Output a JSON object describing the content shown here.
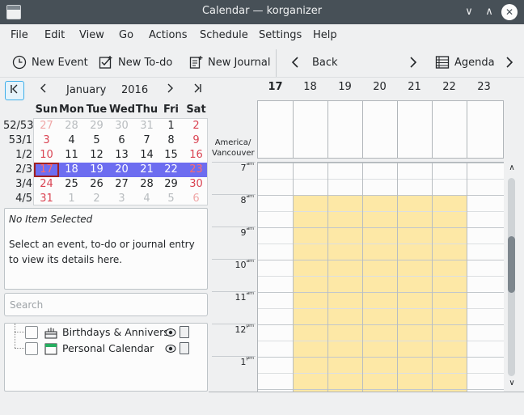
{
  "window": {
    "title": "Calendar  — korganizer",
    "buttons": {
      "minimize": "∨",
      "maximize": "∧",
      "close": "✕"
    }
  },
  "menu": [
    "File",
    "Edit",
    "View",
    "Go",
    "Actions",
    "Schedule",
    "Settings",
    "Help"
  ],
  "toolbar": {
    "new_event": "New Event",
    "new_todo": "New To-do",
    "new_journal": "New Journal",
    "back": "Back",
    "agenda": "Agenda"
  },
  "navigator": {
    "month": "January",
    "year": "2016",
    "day_headers": [
      "Sun",
      "Mon",
      "Tue",
      "Wed",
      "Thu",
      "Fri",
      "Sat"
    ],
    "weeks": [
      {
        "week": "52/53",
        "days": [
          "27",
          "28",
          "29",
          "30",
          "31",
          "1",
          "2"
        ]
      },
      {
        "week": "53/1",
        "days": [
          "3",
          "4",
          "5",
          "6",
          "7",
          "8",
          "9"
        ]
      },
      {
        "week": "1/2",
        "days": [
          "10",
          "11",
          "12",
          "13",
          "14",
          "15",
          "16"
        ]
      },
      {
        "week": "2/3",
        "days": [
          "17",
          "18",
          "19",
          "20",
          "21",
          "22",
          "23"
        ]
      },
      {
        "week": "3/4",
        "days": [
          "24",
          "25",
          "26",
          "27",
          "28",
          "29",
          "30"
        ]
      },
      {
        "week": "4/5",
        "days": [
          "31",
          "1",
          "2",
          "3",
          "4",
          "5",
          "6"
        ]
      }
    ],
    "today": "17",
    "selected_week": "2/3"
  },
  "item_viewer": {
    "heading": "No Item Selected",
    "body": "Select an event, to-do or journal entry to view its details here."
  },
  "search": {
    "placeholder": "Search"
  },
  "calendars": [
    {
      "label": "Birthdays & Anniversaries",
      "checked": false,
      "icon": "birthday-calendar-icon"
    },
    {
      "label": "Personal Calendar",
      "checked": false,
      "icon": "personal-calendar-icon"
    }
  ],
  "agenda": {
    "days": [
      "17",
      "18",
      "19",
      "20",
      "21",
      "22",
      "23"
    ],
    "timezone_line1": "America/",
    "timezone_line2": "Vancouver",
    "hours": [
      {
        "h": "7",
        "s": "am"
      },
      {
        "h": "8",
        "s": "am"
      },
      {
        "h": "9",
        "s": "am"
      },
      {
        "h": "10",
        "s": "am"
      },
      {
        "h": "11",
        "s": "am"
      },
      {
        "h": "12",
        "s": "pm"
      },
      {
        "h": "1",
        "s": "pm"
      }
    ]
  },
  "colors": {
    "accent": "#3daee9",
    "selected_week": "#6d6df0",
    "work_hours": "#fde8a6",
    "weekend_red": "#da4453",
    "titlebar": "#475057"
  }
}
